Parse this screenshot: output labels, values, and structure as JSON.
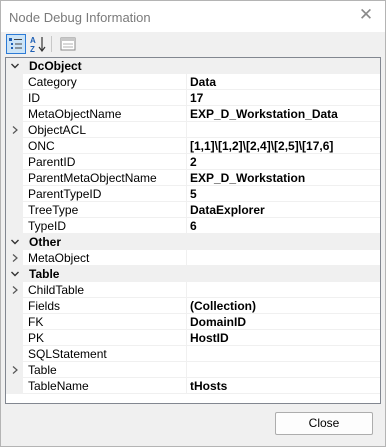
{
  "window": {
    "title": "Node Debug Information",
    "close_glyph": "✕"
  },
  "toolbar": {
    "buttons": [
      {
        "name": "categorized-view",
        "icon": "categorized-icon",
        "active": true
      },
      {
        "name": "alphabetical-view",
        "icon": "sort-az-icon",
        "active": false
      },
      {
        "name": "property-pages",
        "icon": "property-pages-icon",
        "active": false
      }
    ]
  },
  "categories": [
    {
      "label": "DcObject",
      "expanded": true,
      "properties": [
        {
          "name": "Category",
          "value": "Data",
          "expandable": false
        },
        {
          "name": "ID",
          "value": "17",
          "expandable": false
        },
        {
          "name": "MetaObjectName",
          "value": "EXP_D_Workstation_Data",
          "expandable": false
        },
        {
          "name": "ObjectACL",
          "value": "",
          "expandable": true
        },
        {
          "name": "ONC",
          "value": "[1,1]\\[1,2]\\[2,4]\\[2,5]\\[17,6]",
          "expandable": false
        },
        {
          "name": "ParentID",
          "value": "2",
          "expandable": false
        },
        {
          "name": "ParentMetaObjectName",
          "value": "EXP_D_Workstation",
          "expandable": false
        },
        {
          "name": "ParentTypeID",
          "value": "5",
          "expandable": false
        },
        {
          "name": "TreeType",
          "value": "DataExplorer",
          "expandable": false
        },
        {
          "name": "TypeID",
          "value": "6",
          "expandable": false
        }
      ]
    },
    {
      "label": "Other",
      "expanded": true,
      "properties": [
        {
          "name": "MetaObject",
          "value": "",
          "expandable": true
        }
      ]
    },
    {
      "label": "Table",
      "expanded": true,
      "properties": [
        {
          "name": "ChildTable",
          "value": "",
          "expandable": true
        },
        {
          "name": "Fields",
          "value": "(Collection)",
          "expandable": false
        },
        {
          "name": "FK",
          "value": "DomainID",
          "expandable": false
        },
        {
          "name": "PK",
          "value": "HostID",
          "expandable": false
        },
        {
          "name": "SQLStatement",
          "value": "",
          "expandable": false
        },
        {
          "name": "Table",
          "value": "",
          "expandable": true
        },
        {
          "name": "TableName",
          "value": "tHosts",
          "expandable": false
        }
      ]
    }
  ],
  "footer": {
    "close_label": "Close"
  },
  "colors": {
    "window_bg": "#f0f0f0",
    "grid_line": "#f0f0f0",
    "active_tool_border": "#2d7bd6",
    "active_tool_fill": "#cce4f7"
  }
}
